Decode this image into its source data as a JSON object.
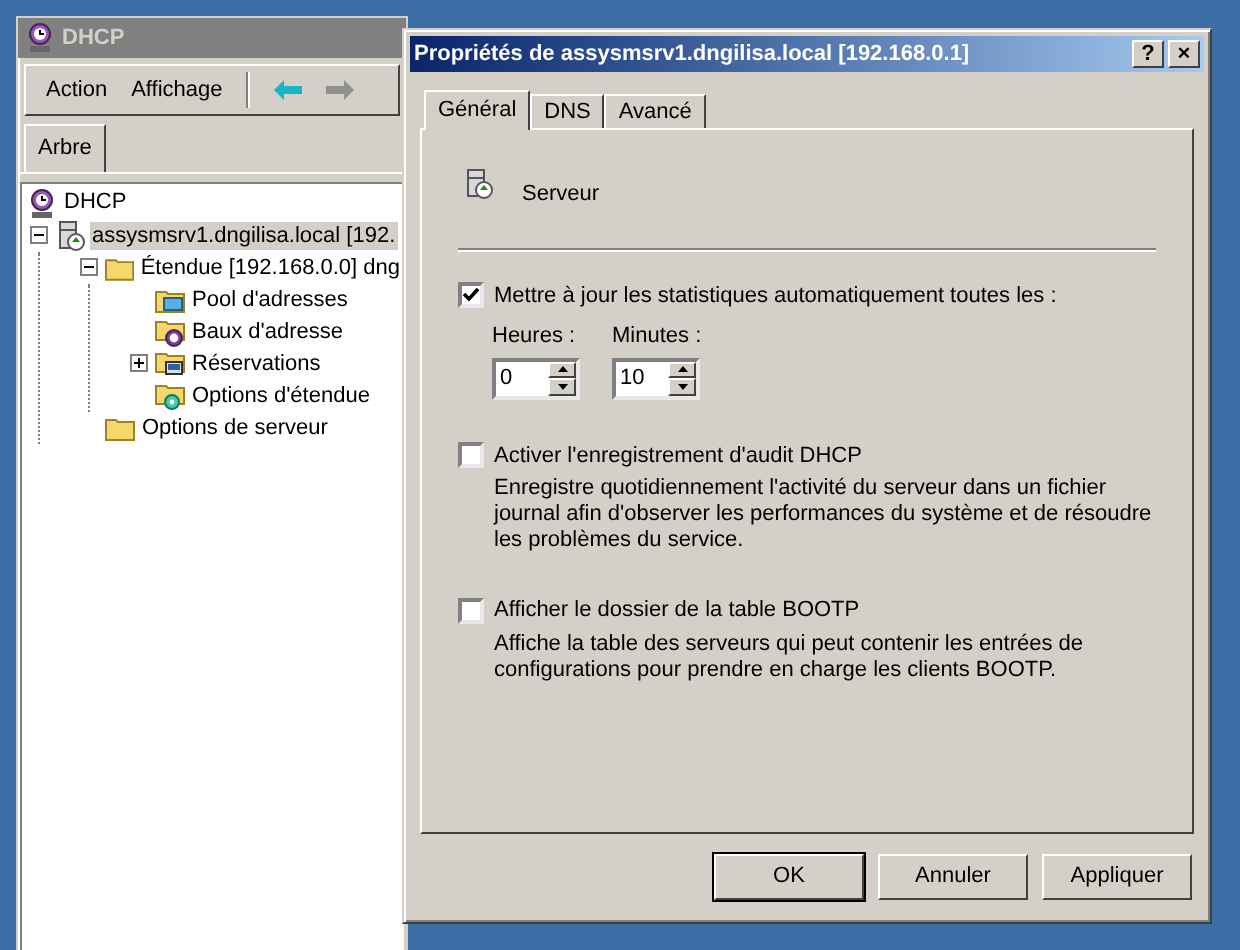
{
  "main_window": {
    "title": "DHCP",
    "menu": [
      {
        "label": "Action"
      },
      {
        "label": "Affichage"
      }
    ],
    "tab": {
      "label": "Arbre",
      "selected": true
    },
    "tree": [
      {
        "label": "DHCP",
        "kind": "dhcp",
        "selected": false,
        "children": [
          {
            "label": "assysmsrv1.dngilisa.local [192.",
            "kind": "server",
            "selected": true,
            "expanded": true,
            "children": [
              {
                "label": "Étendue [192.168.0.0] dng",
                "kind": "folder",
                "selected": false,
                "expanded": true,
                "children": [
                  {
                    "label": "Pool d'adresses",
                    "kind": "pool",
                    "selected": false
                  },
                  {
                    "label": "Baux d'adresse",
                    "kind": "lease",
                    "selected": false
                  },
                  {
                    "label": "Réservations",
                    "kind": "reservation",
                    "selected": false,
                    "expanded": false
                  },
                  {
                    "label": "Options d'étendue",
                    "kind": "options",
                    "selected": false
                  }
                ]
              },
              {
                "label": "Options de serveur",
                "kind": "folder",
                "selected": false
              }
            ]
          }
        ]
      }
    ]
  },
  "dialog": {
    "title": "Propriétés de assysmsrv1.dngilisa.local [192.168.0.1]",
    "title_buttons": [
      "?",
      "×"
    ],
    "tabs": [
      {
        "label": "Général",
        "selected": true
      },
      {
        "label": "DNS",
        "selected": false
      },
      {
        "label": "Avancé",
        "selected": false
      }
    ],
    "header": "Serveur",
    "auto_update": {
      "label": "Mettre à jour les statistiques automatiquement toutes les :",
      "checked": true,
      "fields": [
        {
          "label": "Heures :",
          "value": "0"
        },
        {
          "label": "Minutes :",
          "value": "10"
        }
      ]
    },
    "options": [
      {
        "label": "Activer l'enregistrement d'audit DHCP",
        "checked": false,
        "description": "Enregistre quotidiennement l'activité du serveur dans un fichier journal afin d'observer les performances du système et de résoudre les problèmes du service."
      },
      {
        "label": "Afficher le dossier de la table BOOTP",
        "checked": false,
        "description": "Affiche la table des serveurs qui peut contenir les entrées de configurations pour prendre en charge les clients BOOTP."
      }
    ],
    "buttons": [
      {
        "label": "OK",
        "default": true
      },
      {
        "label": "Annuler",
        "default": false
      },
      {
        "label": "Appliquer",
        "default": false
      }
    ]
  }
}
